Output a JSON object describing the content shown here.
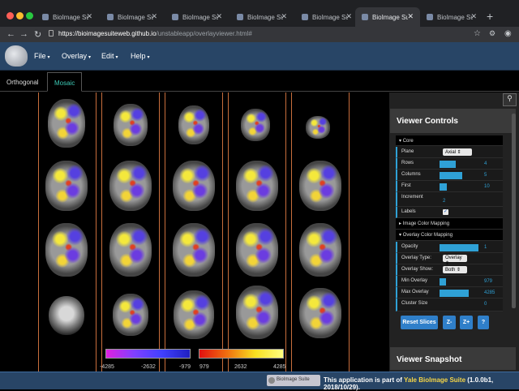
{
  "browser": {
    "tabs": [
      {
        "title": "BioImage Suite",
        "active": false
      },
      {
        "title": "BioImage Suite",
        "active": false
      },
      {
        "title": "BioImage Suite",
        "active": false
      },
      {
        "title": "BioImage Suite",
        "active": false
      },
      {
        "title": "BioImage Suite",
        "active": false
      },
      {
        "title": "BioImage Suite",
        "active": true
      },
      {
        "title": "BioImage Suite",
        "active": false
      }
    ],
    "url_host": "https://bioimagesuiteweb.github.io",
    "url_path": "/unstableapp/overlayviewer.html#"
  },
  "menubar": {
    "items": [
      "File",
      "Overlay",
      "Edit",
      "Help"
    ]
  },
  "view_tabs": {
    "orthogonal": "Orthogonal",
    "mosaic": "Mosaic"
  },
  "colorbar": {
    "ticks_left": [
      "-4285",
      "-2632",
      "-979"
    ],
    "ticks_right": [
      "979",
      "2632",
      "4285"
    ]
  },
  "panel": {
    "title": "Viewer Controls",
    "core_label": "Core",
    "plane_label": "Plane",
    "plane_value": "Axial",
    "rows_label": "Rows",
    "rows_value": "4",
    "columns_label": "Columns",
    "columns_value": "5",
    "first_label": "First",
    "first_value": "10",
    "increment_label": "Increment",
    "increment_value": "2",
    "labels_label": "Labels",
    "image_color_mapping": "Image Color Mapping",
    "overlay_color_mapping": "Overlay Color Mapping",
    "opacity_label": "Opacity",
    "opacity_value": "1",
    "overlay_type_label": "Overlay Type:",
    "overlay_type_value": "Overlay",
    "overlay_show_label": "Overlay Show:",
    "overlay_show_value": "Both",
    "min_overlay_label": "Min Overlay",
    "min_overlay_value": "979",
    "max_overlay_label": "Max Overlay",
    "max_overlay_value": "4285",
    "cluster_size_label": "Cluster Size",
    "cluster_size_value": "0",
    "reset_slices": "Reset Slices",
    "z_minus": "Z-",
    "z_plus": "Z+",
    "help": "?",
    "snapshot_title": "Viewer Snapshot"
  },
  "status": {
    "badge": "BioImage Suite",
    "text_prefix": "This application is part of ",
    "link": "Yale BioImage Suite",
    "version": " (1.0.0b1, 2018/10/29)."
  },
  "colors": {
    "navbar": "#284566",
    "accent": "#2fa1d6",
    "mosaic_tab": "#3cc8b4"
  }
}
